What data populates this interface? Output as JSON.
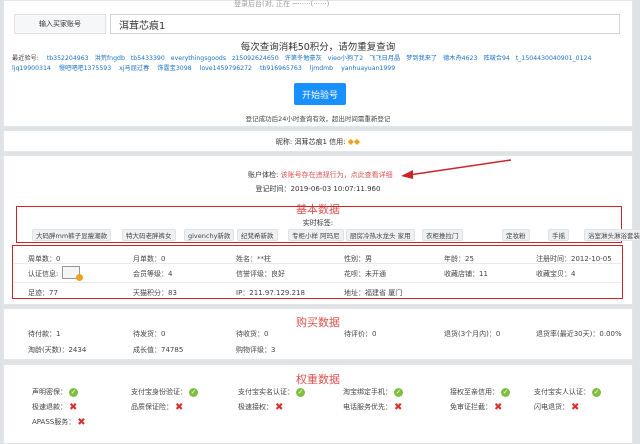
{
  "top_cut": "登录后台(对, 正在 一·····(······)",
  "search": {
    "label": "输入买家账号",
    "value": "洱茸芯痕1",
    "cost_note": "每次查询消耗50积分，请勿重复查询"
  },
  "recent": {
    "label": "最近验号:",
    "row1": [
      "tb352204963",
      "洪荒fngdb",
      "tb5433390",
      "everythingsgoods",
      "z15092624650",
      "许第冬勉豪灰",
      "vieo小狗了2",
      "飞飞日月晶",
      "梦到我来了",
      "德木舟4623",
      "阵啵合94",
      "t_1504430040901_0124"
    ],
    "row2": [
      "ljq19900314",
      "慢吧吧吧1375593",
      "xj马屈过春",
      "饰霆宝3098",
      "love1459796272",
      "tb916965763",
      "ljmdmb",
      "yanhuayuan1999"
    ]
  },
  "start_button": "开始验号",
  "login_note": "登记成功后24小时查询有效，超出时间需重新登记",
  "nick": {
    "label": "昵称:",
    "value": "洱茸芯痕1 信用:"
  },
  "account_status": {
    "label": "账户体检:",
    "value": "该账号存在违规行为，点此查看详细",
    "reg_time": "登记时间：2019-06-03 10:07:11.960"
  },
  "basic": {
    "title": "基本数据",
    "tags_label": "实时标签:",
    "tags": [
      "大码胖mm裤子显瘦潮款",
      "特大码老胖裤女",
      "givenchy新款",
      "纪梵希新款",
      "专柜小样 阿玛尼",
      "厨房冷热水龙头 家用",
      "衣柜推拉门",
      "定妆粉",
      "手摇",
      "浴室淋头淋浴套装"
    ],
    "rows": [
      [
        "周单数：0",
        "月单数：0",
        "姓名：**柱",
        "性别：男",
        "年龄：25",
        "注册时间：2012-10-05"
      ],
      [
        "认证信息:",
        "会员等级：4",
        "信誉评级：良好",
        "花呗：未开通",
        "收藏店铺：11",
        "收藏宝贝：4"
      ],
      [
        "足迹：77",
        "天猫积分：83",
        "IP：211.97.129.218",
        "地址：福建省 厦门",
        "",
        ""
      ]
    ]
  },
  "purchase": {
    "title": "购买数据",
    "rows": [
      [
        "待付款：1",
        "待发货：0",
        "待收货：0",
        "待评价：0",
        "退货(3个月内)：0",
        "退货率(最近30天)：0.00%"
      ],
      [
        "淘龄(天数)：2434",
        "成长值：74785",
        "购物评级：3",
        "",
        "",
        ""
      ]
    ]
  },
  "rights": {
    "title": "权重数据",
    "items": [
      {
        "label": "声明密保：",
        "ok": true
      },
      {
        "label": "支付宝身份验证：",
        "ok": true
      },
      {
        "label": "支付宝实名认证：",
        "ok": true
      },
      {
        "label": "淘宝绑定手机：",
        "ok": true
      },
      {
        "label": "接权至亲信用：",
        "ok": true
      },
      {
        "label": "支付宝实人认证：",
        "ok": true
      },
      {
        "label": "极速退款：",
        "ok": false
      },
      {
        "label": "品质保证险：",
        "ok": false
      },
      {
        "label": "极速接权：",
        "ok": false
      },
      {
        "label": "电话服务优先：",
        "ok": false
      },
      {
        "label": "免审证拦截：",
        "ok": false
      },
      {
        "label": "闪电退货：",
        "ok": false
      },
      {
        "label": "APASS服务：",
        "ok": false
      }
    ]
  },
  "colors": {
    "primary": "#1890ff",
    "warn_red": "#d9534f",
    "box_red": "#c9252b",
    "ok_green": "#7fbf3f"
  }
}
